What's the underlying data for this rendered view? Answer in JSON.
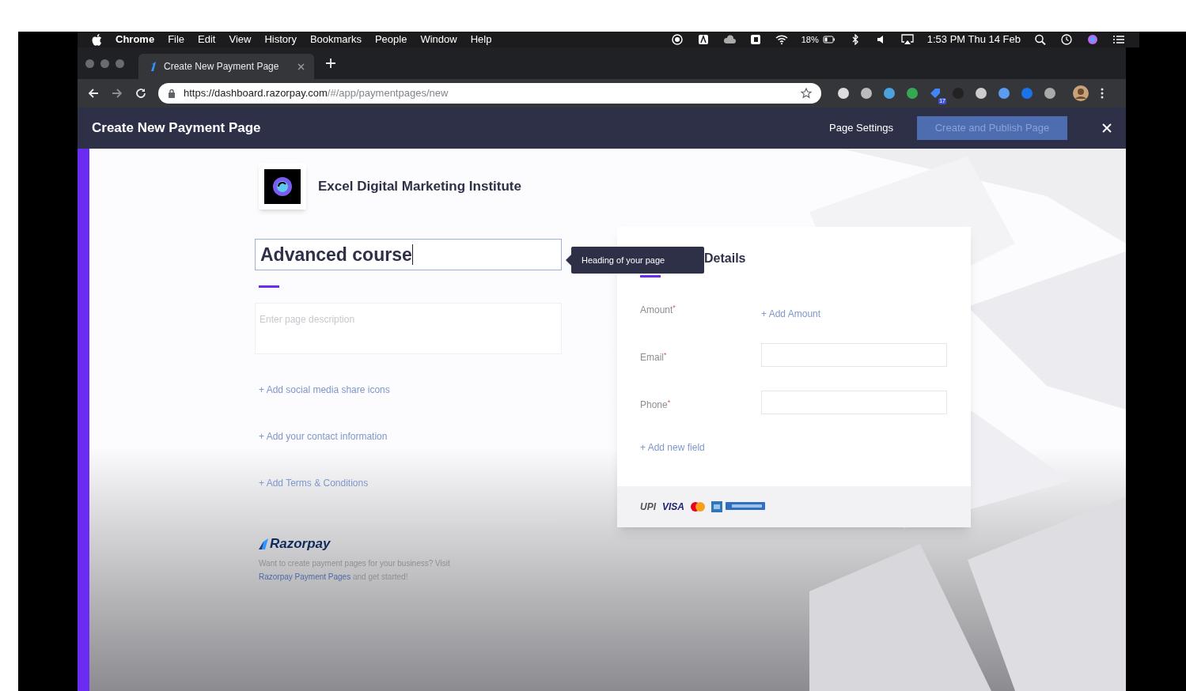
{
  "menubar": {
    "app_name": "Chrome",
    "items": [
      "File",
      "Edit",
      "View",
      "History",
      "Bookmarks",
      "People",
      "Window",
      "Help"
    ],
    "battery_text": "18%",
    "clock": "1:53 PM Thu 14 Feb"
  },
  "browser": {
    "tabs": [
      {
        "title": "Create New Payment Page",
        "selected": true
      }
    ],
    "url_host": "https://dashboard.razorpay.com",
    "url_path": "/#/app/paymentpages/new",
    "extension_badge": "17"
  },
  "app_header": {
    "title": "Create New Payment Page",
    "settings_link": "Page Settings",
    "publish_button": {
      "label": "Create and Publish Page",
      "disabled": true
    }
  },
  "page": {
    "business_name": "Excel Digital Marketing Institute",
    "title_input": {
      "value": "Advanced course",
      "focused": true
    },
    "tooltip": "Heading of your page",
    "description": {
      "placeholder": "Enter page description"
    },
    "links": [
      "+ Add social media share icons",
      "+ Add your contact information",
      "+ Add Terms & Conditions"
    ],
    "footer": {
      "brand": "Razorpay",
      "text": "Want to create payment pages for your business? Visit",
      "link": "Razorpay Payment Pages",
      "text_end": "and get started!"
    }
  },
  "details_card": {
    "heading": "Details",
    "fields": [
      {
        "label": "Amount",
        "mark": "*",
        "kind": "link",
        "action": "+ Add Amount"
      },
      {
        "label": "Email",
        "mark": "*",
        "kind": "input"
      },
      {
        "label": "Phone",
        "mark": "*",
        "kind": "input"
      }
    ],
    "add_field": "+ Add new field",
    "payment_logos": [
      "UPI",
      "VISA"
    ]
  }
}
